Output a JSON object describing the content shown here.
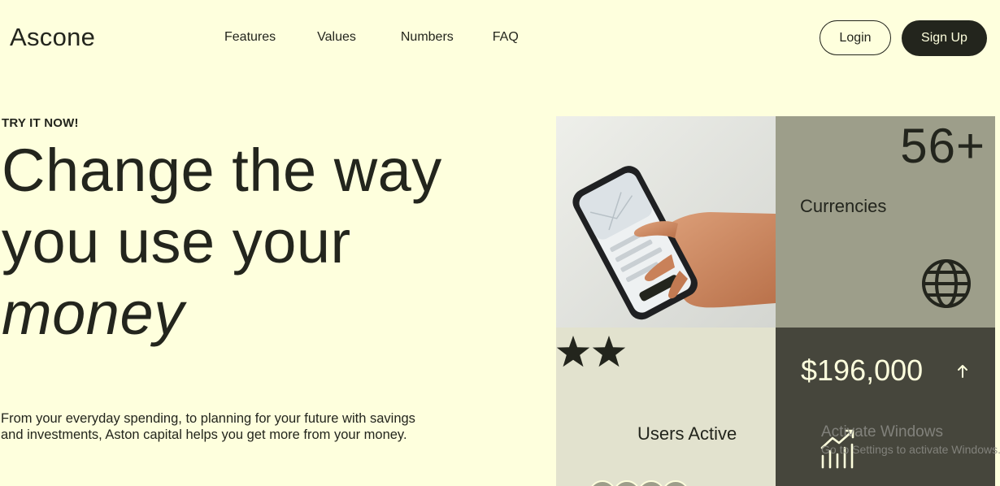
{
  "brand": {
    "name": "Ascone"
  },
  "nav": {
    "items": [
      "Features",
      "Values",
      "Numbers",
      "FAQ"
    ]
  },
  "auth": {
    "login_label": "Login",
    "signup_label": "Sign Up"
  },
  "hero": {
    "eyebrow": "TRY IT NOW!",
    "headline_line1": "Change the way",
    "headline_line2": "you use your",
    "headline_emphasis": "money",
    "description": "From your everyday spending, to planning for your future with savings and investments, Aston capital helps you get more from your money."
  },
  "stats": {
    "currencies": {
      "value": "56+",
      "label": "Currencies",
      "icon": "globe-icon"
    },
    "users": {
      "label": "Users Active",
      "rating_stars_visible": 2,
      "icon": "star-icon"
    },
    "revenue": {
      "value": "$196,000",
      "trend_icon": "arrow-up-icon",
      "chart_icon": "growth-chart-icon"
    }
  },
  "os_watermark": {
    "title": "Activate Windows",
    "subtitle": "Go to Settings to activate Windows."
  },
  "colors": {
    "background": "#FEFFDD",
    "text": "#23251D",
    "tile_sage": "#9D9E8A",
    "tile_cream": "#E2E2CE",
    "tile_dark": "#46463C"
  }
}
